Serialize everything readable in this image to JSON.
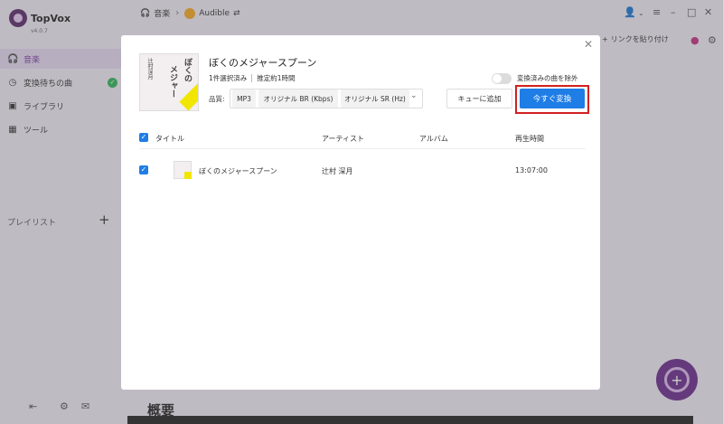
{
  "app": {
    "name": "TopVox",
    "version": "v4.0.7"
  },
  "breadcrumb": {
    "music": "音楽",
    "service": "Audible"
  },
  "sidebar": {
    "items": [
      {
        "label": "音楽",
        "icon": "headphones-icon"
      },
      {
        "label": "変換待ちの曲",
        "icon": "clock-icon"
      },
      {
        "label": "ライブラリ",
        "icon": "library-icon"
      },
      {
        "label": "ツール",
        "icon": "grid-icon"
      }
    ],
    "playlist_label": "プレイリスト"
  },
  "main": {
    "paste_link": "リンクを貼り付け",
    "overview": "概要"
  },
  "modal": {
    "title": "ぼくのメジャースプーン",
    "selected": "1件選択済み",
    "estimate": "推定約1時間",
    "exclude_label": "変換済みの曲を除外",
    "quality_label": "品質:",
    "format": "MP3",
    "bitrate": "オリジナル BR (Kbps)",
    "samplerate": "オリジナル SR (Hz)",
    "queue_button": "キューに追加",
    "convert_button": "今すぐ変換",
    "columns": {
      "title": "タイトル",
      "artist": "アーティスト",
      "album": "アルバム",
      "duration": "再生時間"
    },
    "rows": [
      {
        "title": "ぼくのメジャースプーン",
        "artist": "辻村 深月",
        "album": "",
        "duration": "13:07:00"
      }
    ]
  },
  "colors": {
    "accent": "#1f7de6",
    "highlight": "#d32020",
    "brand": "#6a2c8c"
  }
}
